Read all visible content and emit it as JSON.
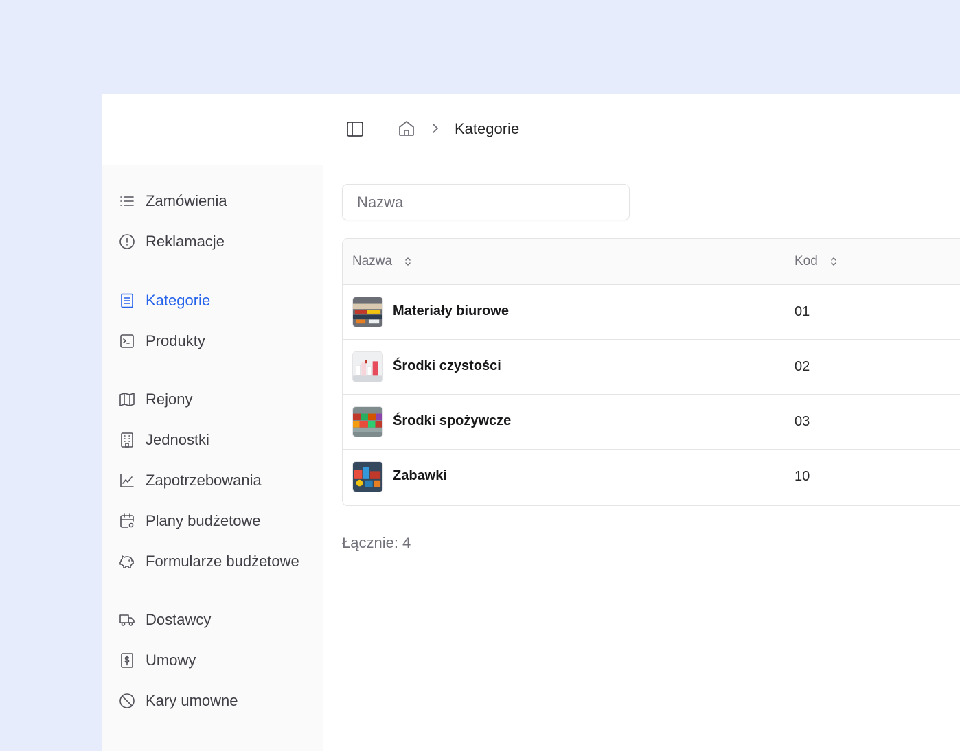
{
  "breadcrumb": {
    "current": "Kategorie"
  },
  "sidebar": {
    "groups": [
      [
        {
          "label": "Zamówienia",
          "icon": "list-icon"
        },
        {
          "label": "Reklamacje",
          "icon": "alert-circle-icon"
        }
      ],
      [
        {
          "label": "Kategorie",
          "icon": "document-icon",
          "active": true
        },
        {
          "label": "Produkty",
          "icon": "terminal-box-icon"
        }
      ],
      [
        {
          "label": "Rejony",
          "icon": "map-icon"
        },
        {
          "label": "Jednostki",
          "icon": "building-icon"
        },
        {
          "label": "Zapotrzebowania",
          "icon": "line-chart-icon"
        },
        {
          "label": "Plany budżetowe",
          "icon": "calendar-cog-icon"
        },
        {
          "label": "Formularze budżetowe",
          "icon": "piggy-bank-icon"
        }
      ],
      [
        {
          "label": "Dostawcy",
          "icon": "truck-icon"
        },
        {
          "label": "Umowy",
          "icon": "dollar-document-icon"
        },
        {
          "label": "Kary umowne",
          "icon": "ban-icon"
        }
      ]
    ]
  },
  "search": {
    "placeholder": "Nazwa"
  },
  "table": {
    "columns": {
      "name": "Nazwa",
      "code": "Kod"
    },
    "rows": [
      {
        "name": "Materiały biurowe",
        "code": "01",
        "thumb": "office-supplies"
      },
      {
        "name": "Środki czystości",
        "code": "02",
        "thumb": "cleaning-products"
      },
      {
        "name": "Środki spożywcze",
        "code": "03",
        "thumb": "groceries"
      },
      {
        "name": "Zabawki",
        "code": "10",
        "thumb": "toys"
      }
    ]
  },
  "footer": {
    "total": "Łącznie: 4"
  },
  "colors": {
    "accent": "#2563eb",
    "background": "#e6ecfc"
  }
}
